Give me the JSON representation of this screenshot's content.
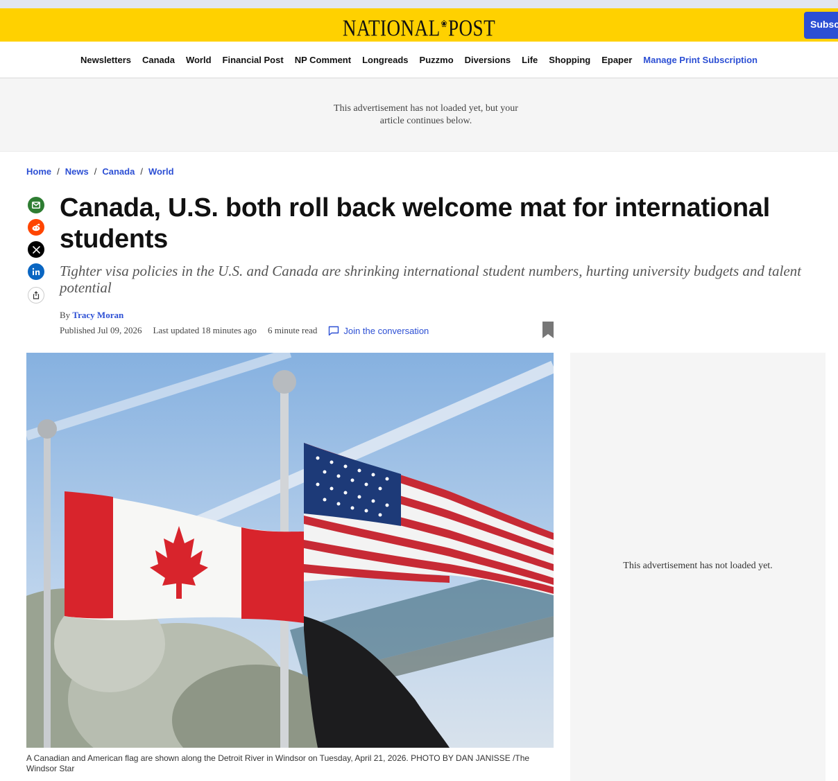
{
  "header": {
    "logo_left": "NATIONAL",
    "logo_right": "POST",
    "subscribe_label": "Subscr",
    "brand_color": "#ffd100",
    "accent_color": "#2c4fd4"
  },
  "nav": {
    "items": [
      "Newsletters",
      "Canada",
      "World",
      "Financial Post",
      "NP Comment",
      "Longreads",
      "Puzzmo",
      "Diversions",
      "Life",
      "Shopping",
      "Epaper"
    ],
    "highlight": "Manage Print Subscription"
  },
  "ad_banner": {
    "line1": "This advertisement has not loaded yet, but your",
    "line2": "article continues below."
  },
  "breadcrumb": [
    "Home",
    "News",
    "Canada",
    "World"
  ],
  "share_icons": [
    "email-icon",
    "reddit-icon",
    "x-icon",
    "linkedin-icon",
    "share-icon"
  ],
  "article": {
    "headline": "Canada, U.S. both roll back welcome mat for international students",
    "deck": "Tighter visa policies in the U.S. and Canada are shrinking international student numbers, hurting university budgets and talent potential",
    "by_prefix": "By",
    "author": "Tracy Moran",
    "published": "Published Jul 09, 2026",
    "updated": "Last updated 18 minutes ago",
    "read_time": "6 minute read",
    "join": "Join the conversation",
    "caption": "A Canadian and American flag are shown along the Detroit River in Windsor on Tuesday, April 21, 2026. PHOTO BY DAN JANISSE /The Windsor Star"
  },
  "side_ad": {
    "text": "This advertisement has not loaded yet."
  }
}
